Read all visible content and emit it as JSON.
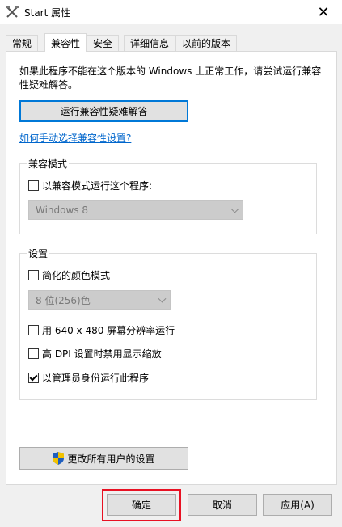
{
  "window": {
    "title": "Start 属性",
    "close_glyph": "✕"
  },
  "tabs": [
    {
      "label": "常规"
    },
    {
      "label": "兼容性",
      "active": true
    },
    {
      "label": "安全"
    },
    {
      "label": "详细信息"
    },
    {
      "label": "以前的版本"
    }
  ],
  "compat": {
    "description": "如果此程序不能在这个版本的 Windows 上正常工作，请尝试运行兼容性疑难解答。",
    "troubleshoot_button": "运行兼容性疑难解答",
    "manual_link": "如何手动选择兼容性设置?"
  },
  "mode_group": {
    "label": "兼容模式",
    "run_in_mode": {
      "label": "以兼容模式运行这个程序:",
      "checked": false
    },
    "os_select": {
      "value": "Windows 8",
      "disabled": true
    }
  },
  "settings_group": {
    "label": "设置",
    "reduced_color": {
      "label": "简化的颜色模式",
      "checked": false
    },
    "color_select": {
      "value": "8 位(256)色",
      "disabled": true
    },
    "res_640": {
      "label": "用 640 x 480 屏幕分辨率运行",
      "checked": false
    },
    "high_dpi": {
      "label": "高 DPI 设置时禁用显示缩放",
      "checked": false
    },
    "run_admin": {
      "label": "以管理员身份运行此程序",
      "checked": true
    }
  },
  "all_users_button": "更改所有用户的设置",
  "footer": {
    "ok": "确定",
    "cancel": "取消",
    "apply": "应用(A)"
  },
  "colors": {
    "accent": "#0078d7",
    "highlight_box": "#e81123",
    "link": "#0066cc"
  },
  "icons": {
    "app": "crossed-tools-icon",
    "close": "close-icon",
    "shield": "uac-shield-icon",
    "dropdown": "chevron-down-icon"
  }
}
